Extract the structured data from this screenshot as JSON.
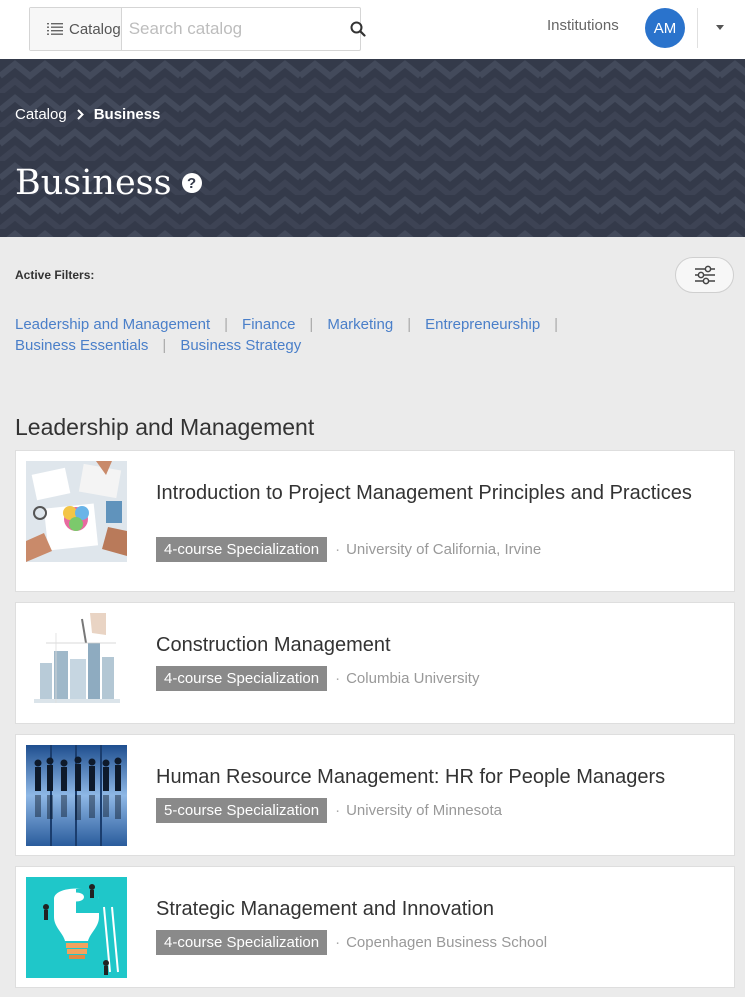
{
  "header": {
    "catalog_label": "Catalog",
    "search_placeholder": "Search catalog",
    "institutions_label": "Institutions",
    "avatar_initials": "AM"
  },
  "breadcrumb": {
    "root": "Catalog",
    "current": "Business"
  },
  "hero": {
    "title": "Business",
    "help_symbol": "?"
  },
  "filters": {
    "label": "Active Filters:",
    "links": [
      "Leadership and Management",
      "Finance",
      "Marketing",
      "Entrepreneurship",
      "Business Essentials",
      "Business Strategy"
    ],
    "separator": "|"
  },
  "section": {
    "title": "Leadership and Management",
    "courses": [
      {
        "title": "Introduction to Project Management Principles and Practices",
        "badge": "4-course Specialization",
        "separator": "·",
        "partner": "University of California, Irvine",
        "thumb_icon": "office-desk-thumbnail"
      },
      {
        "title": "Construction Management",
        "badge": "4-course Specialization",
        "separator": "·",
        "partner": "Columbia University",
        "thumb_icon": "city-sketch-thumbnail"
      },
      {
        "title": "Human Resource Management: HR for People Managers",
        "badge": "5-course Specialization",
        "separator": "·",
        "partner": "University of Minnesota",
        "thumb_icon": "silhouettes-thumbnail"
      },
      {
        "title": "Strategic Management and Innovation",
        "badge": "4-course Specialization",
        "separator": "·",
        "partner": "Copenhagen Business School",
        "thumb_icon": "lightbulb-puzzle-thumbnail"
      }
    ]
  },
  "colors": {
    "hero_bg": "#343a4a",
    "link": "#4a7fc9",
    "avatar": "#2a73cc",
    "badge": "#8a8a8a"
  }
}
